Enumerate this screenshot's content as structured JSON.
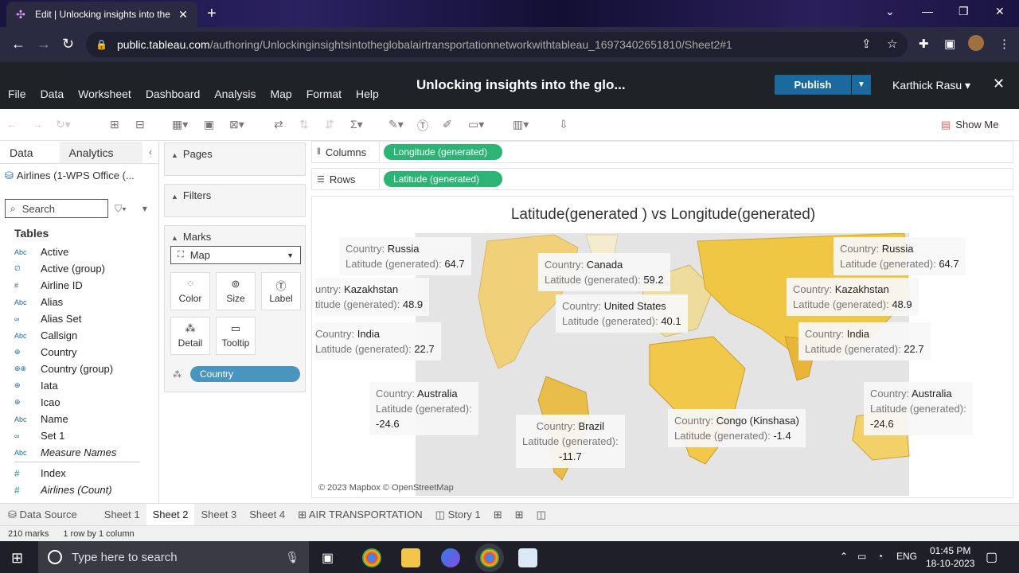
{
  "browser": {
    "tab_title": "Edit | Unlocking insights into the",
    "url_domain": "public.tableau.com",
    "url_path": "/authoring/Unlockinginsightsintotheglobalairtransportationnetworkwithtableau_16973402651810/Sheet2#1"
  },
  "tableau": {
    "menu": [
      "File",
      "Data",
      "Worksheet",
      "Dashboard",
      "Analysis",
      "Map",
      "Format",
      "Help"
    ],
    "workbook_title": "Unlocking insights into the glo...",
    "publish_label": "Publish",
    "user_name": "Karthick Rasu",
    "show_me_label": "Show Me"
  },
  "data_pane": {
    "tab_data": "Data",
    "tab_analytics": "Analytics",
    "source": "Airlines (1-WPS Office (...",
    "search_placeholder": "Search",
    "tables_heading": "Tables",
    "fields": [
      {
        "type": "Abc",
        "name": "Active"
      },
      {
        "type": "∅",
        "name": "Active (group)"
      },
      {
        "type": "#",
        "name": "Airline ID"
      },
      {
        "type": "Abc",
        "name": "Alias"
      },
      {
        "type": "∞",
        "name": "Alias Set"
      },
      {
        "type": "Abc",
        "name": "Callsign"
      },
      {
        "type": "⊕",
        "name": "Country"
      },
      {
        "type": "⊕⊕",
        "name": "Country (group)"
      },
      {
        "type": "⊕",
        "name": "Iata"
      },
      {
        "type": "⊕",
        "name": "Icao"
      },
      {
        "type": "Abc",
        "name": "Name"
      },
      {
        "type": "∞",
        "name": "Set 1"
      },
      {
        "type": "Abc",
        "name": "Measure Names"
      }
    ],
    "measures": [
      {
        "type": "#",
        "name": "Index"
      },
      {
        "type": "#",
        "name": "Airlines (Count)"
      }
    ]
  },
  "cards": {
    "pages": "Pages",
    "filters": "Filters",
    "marks": "Marks",
    "mark_type": "Map",
    "buttons": [
      "Color",
      "Size",
      "Label",
      "Detail",
      "Tooltip"
    ],
    "detail_pill": "Country"
  },
  "shelves": {
    "columns_label": "Columns",
    "columns_pill": "Longitude (generated)",
    "rows_label": "Rows",
    "rows_pill": "Latitude (generated)"
  },
  "viz": {
    "title": "Latitude(generated ) vs Longitude(generated)",
    "attribution": "© 2023 Mapbox  © OpenStreetMap",
    "tooltips": [
      {
        "country": "Russia",
        "lat": "64.7"
      },
      {
        "country": "Canada",
        "lat": "59.2"
      },
      {
        "country": "Russia",
        "lat": "64.7"
      },
      {
        "country": "Kazakhstan",
        "lat": "48.9"
      },
      {
        "country": "Kazakhstan",
        "lat": "48.9"
      },
      {
        "country": "United States",
        "lat": "40.1"
      },
      {
        "country": "India",
        "lat": "22.7"
      },
      {
        "country": "India",
        "lat": "22.7"
      },
      {
        "country": "Australia",
        "lat": "-24.6"
      },
      {
        "country": "Australia",
        "lat": "-24.6"
      },
      {
        "country": "Brazil",
        "lat": "-11.7"
      },
      {
        "country": "Congo (Kinshasa)",
        "lat": "-1.4"
      }
    ],
    "country_prefix": "Country: ",
    "lat_prefix": "Latitude (generated): ",
    "lat_prefix_cut": "titude (generated): ",
    "country_prefix_cut": "untry: "
  },
  "sheets": {
    "data_source": "Data Source",
    "tabs": [
      "Sheet 1",
      "Sheet 2",
      "Sheet 3",
      "Sheet 4",
      "AIR TRANSPORTATION",
      "Story 1"
    ],
    "active": "Sheet 2"
  },
  "status": {
    "marks": "210 marks",
    "dims": "1 row by 1 column"
  },
  "taskbar": {
    "search_placeholder": "Type here to search",
    "lang": "ENG",
    "time": "01:45 PM",
    "date": "18-10-2023"
  }
}
